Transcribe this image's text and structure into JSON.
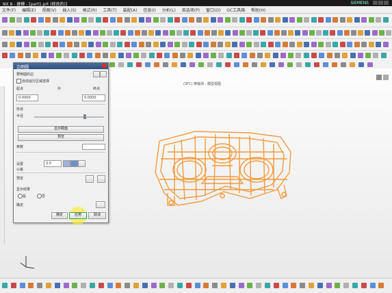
{
  "window": {
    "title": "NX 8 - 建模 - [part1.prt (修改的)]",
    "brand": "SIEMENS"
  },
  "menu": [
    "文件(F)",
    "编辑(E)",
    "视图(V)",
    "插入(S)",
    "格式(R)",
    "工具(T)",
    "装配(A)",
    "信息(I)",
    "分析(L)",
    "首选项(P)",
    "窗口(O)",
    "GC工具箱",
    "帮助(H)"
  ],
  "view": {
    "title": "(SFC) 等轴测 - 模型视图"
  },
  "dialog": {
    "title": "边倒圆",
    "section1": "要倒圆的边",
    "option_label": "自动运行区域选择",
    "left_label": "起点",
    "mid_label": "中",
    "right_label": "终点",
    "value_left": "0.0000",
    "value_right": "0.0000",
    "section2": "形状",
    "slider_label": "半径",
    "button_wide_1": "显示截面",
    "button_wide_2": "预览",
    "field_label": "参数",
    "field_value": "",
    "section3": "设置",
    "combo_label": "公差",
    "combo_value": "0.0",
    "section4": "预览",
    "preview_label": "显示结果",
    "radio_1": "是",
    "radio_2": "否",
    "status": "确定",
    "ok": "确定",
    "apply": "应用",
    "cancel": "取消"
  },
  "colors": {
    "model": "#f39a3c",
    "dialog_header": "#3a5e92",
    "highlight": "#ffe63c"
  }
}
